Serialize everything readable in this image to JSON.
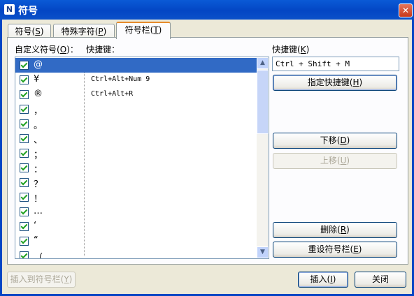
{
  "window": {
    "title": "符号",
    "app_icon_text": "N",
    "close_glyph": "✕"
  },
  "tabs": [
    {
      "label": "符号",
      "accel": "S"
    },
    {
      "label": "特殊字符",
      "accel": "P"
    },
    {
      "label": "符号栏",
      "accel": "T"
    }
  ],
  "list": {
    "header_symbols": "自定义符号",
    "header_symbols_accel": "O",
    "header_shortcut": "快捷键：",
    "items": [
      {
        "symbol": "@",
        "shortcut": "",
        "checked": true,
        "selected": true
      },
      {
        "symbol": "¥",
        "shortcut": "Ctrl+Alt+Num 9",
        "checked": true
      },
      {
        "symbol": "®",
        "shortcut": "Ctrl+Alt+R",
        "checked": true
      },
      {
        "symbol": "，",
        "shortcut": "",
        "checked": true
      },
      {
        "symbol": "。",
        "shortcut": "",
        "checked": true
      },
      {
        "symbol": "、",
        "shortcut": "",
        "checked": true
      },
      {
        "symbol": "；",
        "shortcut": "",
        "checked": true
      },
      {
        "symbol": "：",
        "shortcut": "",
        "checked": true
      },
      {
        "symbol": "？",
        "shortcut": "",
        "checked": true
      },
      {
        "symbol": "！",
        "shortcut": "",
        "checked": true
      },
      {
        "symbol": "…",
        "shortcut": "",
        "checked": true
      },
      {
        "symbol": "‘",
        "shortcut": "",
        "checked": true
      },
      {
        "symbol": "“",
        "shortcut": "",
        "checked": true
      },
      {
        "symbol": "（",
        "shortcut": "",
        "checked": true
      }
    ],
    "scroll_up_glyph": "▲",
    "scroll_down_glyph": "▼"
  },
  "shortcut_panel": {
    "label": "快捷键",
    "label_accel": "K",
    "value": "Ctrl + Shift + M",
    "assign_button": "指定快捷键",
    "assign_accel": "H",
    "move_down_button": "下移",
    "move_down_accel": "D",
    "move_up_button": "上移",
    "move_up_accel": "U",
    "delete_button": "删除",
    "delete_accel": "R",
    "reset_button": "重设符号栏",
    "reset_accel": "E"
  },
  "footer": {
    "insert_to_bar_button": "插入到符号栏",
    "insert_to_bar_accel": "Y",
    "insert_button": "插入",
    "insert_accel": "I",
    "close_button": "关闭"
  }
}
